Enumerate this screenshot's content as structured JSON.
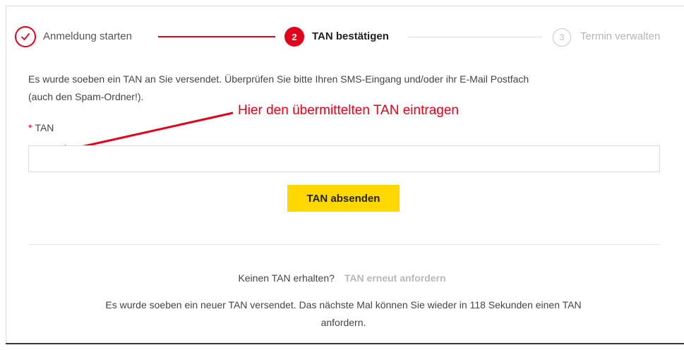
{
  "steps": [
    {
      "number": "1",
      "label": "Anmeldung starten",
      "state": "done"
    },
    {
      "number": "2",
      "label": "TAN bestätigen",
      "state": "active"
    },
    {
      "number": "3",
      "label": "Termin verwalten",
      "state": "pending"
    }
  ],
  "info_line1": "Es wurde soeben ein TAN an Sie versendet. Überprüfen Sie bitte Ihren SMS-Eingang und/oder ihr E-Mail Postfach",
  "info_line2": "(auch den Spam-Ordner!).",
  "annotation": "Hier den übermittelten TAN eintragen",
  "field": {
    "required_mark": "*",
    "label": "TAN",
    "value": ""
  },
  "submit_label": "TAN absenden",
  "resend": {
    "question": "Keinen TAN erhalten?",
    "link": "TAN erneut anfordern"
  },
  "notice_line1": "Es wurde soeben ein neuer TAN versendet. Das nächste Mal können Sie wieder in 118 Sekunden einen TAN",
  "notice_line2": "anfordern.",
  "colors": {
    "accent": "#e2001a",
    "button": "#ffd800"
  },
  "icons": {
    "step_done": "check-icon",
    "annotation": "arrow-icon"
  }
}
